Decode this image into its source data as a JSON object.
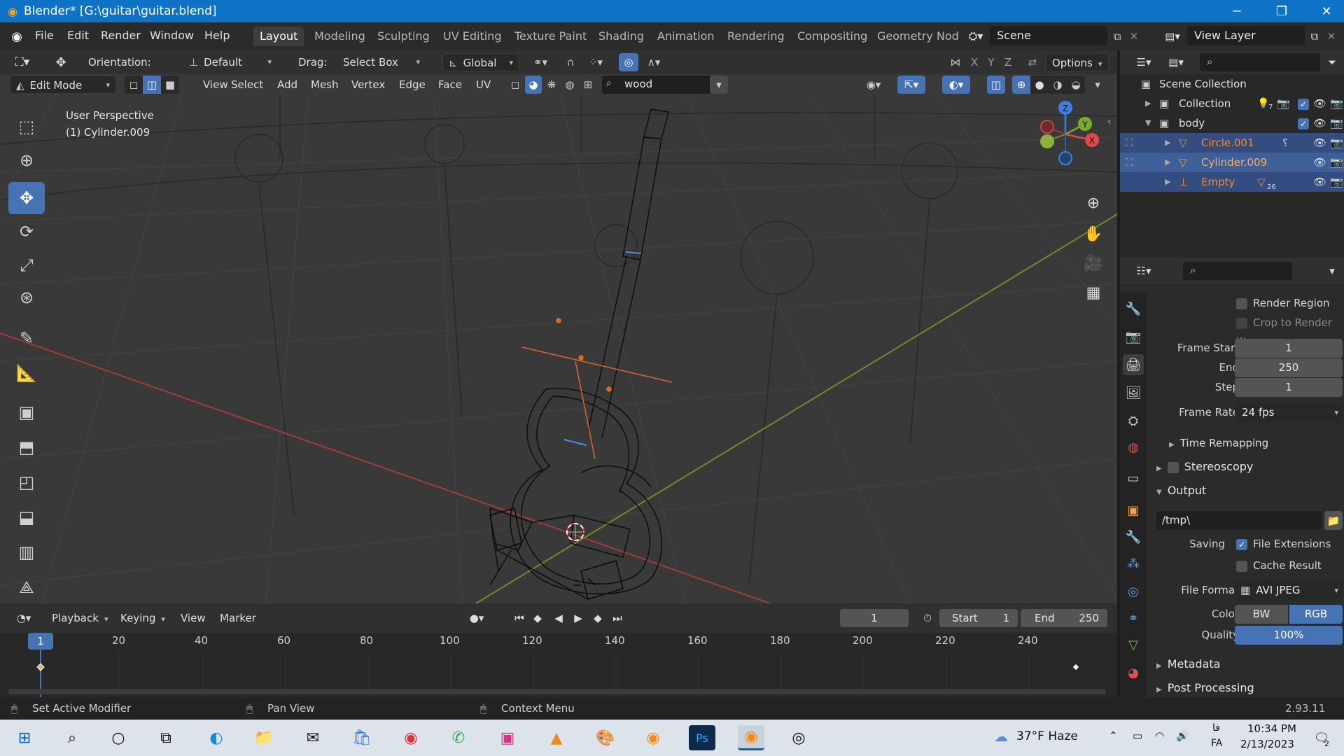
{
  "window": {
    "title": "Blender* [G:\\guitar\\guitar.blend]"
  },
  "menu": [
    "File",
    "Edit",
    "Render",
    "Window",
    "Help"
  ],
  "workspaces": [
    "Layout",
    "Modeling",
    "Sculpting",
    "UV Editing",
    "Texture Paint",
    "Shading",
    "Animation",
    "Rendering",
    "Compositing",
    "Geometry Nod"
  ],
  "scene": {
    "name": "Scene",
    "view_layer": "View Layer"
  },
  "tool_header": {
    "orientation_label": "Orientation:",
    "orientation_value": "Default",
    "drag_label": "Drag:",
    "drag_value": "Select Box",
    "transform_value": "Global",
    "axes": [
      "X",
      "Y",
      "Z"
    ],
    "options_label": "Options"
  },
  "editor_header": {
    "mode": "Edit Mode",
    "menus": [
      "View",
      "Select",
      "Add",
      "Mesh",
      "Vertex",
      "Edge",
      "Face",
      "UV"
    ],
    "search_value": "wood"
  },
  "viewport": {
    "perspective": "User Perspective",
    "object_label": "(1) Cylinder.009"
  },
  "gizmo": {
    "x": "X",
    "y": "Y",
    "z": "Z"
  },
  "timeline": {
    "menus": [
      "Playback",
      "Keying",
      "View",
      "Marker"
    ],
    "current_frame": "1",
    "start_label": "Start",
    "start_value": "1",
    "end_label": "End",
    "end_value": "250",
    "playhead": "1",
    "ticks": [
      "20",
      "40",
      "60",
      "80",
      "100",
      "120",
      "140",
      "160",
      "180",
      "200",
      "220",
      "240"
    ]
  },
  "outliner": {
    "rows": [
      {
        "name": "Scene Collection",
        "color": "#e0e0e0"
      },
      {
        "name": "Collection",
        "color": "#e0e0e0",
        "badge": "7"
      },
      {
        "name": "body",
        "color": "#e0e0e0"
      },
      {
        "name": "Circle.001",
        "color": "#f08a3a"
      },
      {
        "name": "Cylinder.009",
        "color": "#f0a050"
      },
      {
        "name": "Empty",
        "color": "#f08a3a",
        "badge": "26"
      }
    ]
  },
  "properties": {
    "render_region": "Render Region",
    "crop_to_render": "Crop to Render ...",
    "frame_start_label": "Frame Start",
    "frame_start": "1",
    "end_label": "End",
    "end": "250",
    "step_label": "Step",
    "step": "1",
    "frame_rate_label": "Frame Rate",
    "frame_rate": "24 fps",
    "time_remapping": "Time Remapping",
    "stereoscopy": "Stereoscopy",
    "output": "Output",
    "output_path": "/tmp\\",
    "saving_label": "Saving",
    "file_extensions": "File Extensions",
    "cache_result": "Cache Result",
    "file_format_label": "File Format",
    "file_format": "AVI JPEG",
    "color_label": "Color",
    "color_bw": "BW",
    "color_rgb": "RGB",
    "quality_label": "Quality",
    "quality": "100%",
    "quality_fraction": 1.0,
    "metadata": "Metadata",
    "post_processing": "Post Processing"
  },
  "statusbar": {
    "left": "Set Active Modifier",
    "mid": "Pan View",
    "right": "Context Menu",
    "version": "2.93.11"
  },
  "taskbar": {
    "weather": "37°F  Haze",
    "lang_top": "فا",
    "lang_bottom": "FA",
    "time": "10:34 PM",
    "date": "2/13/2023",
    "notifications": "2"
  },
  "colors": {
    "accent": "#4772b3",
    "selection": "#334d80",
    "object_orange": "#f08a3a"
  }
}
